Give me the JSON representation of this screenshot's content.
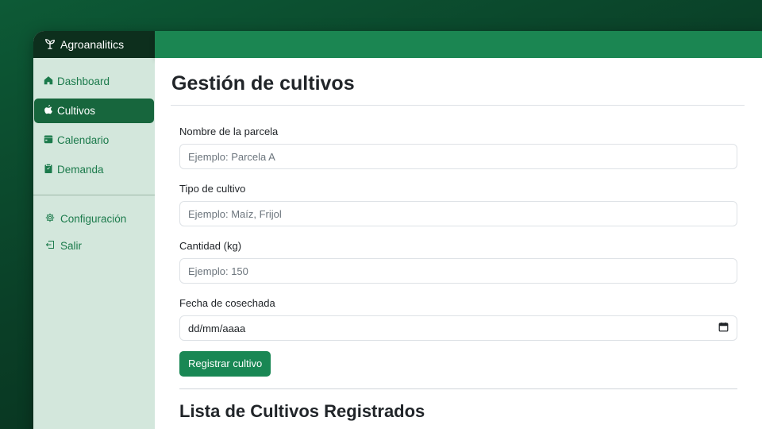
{
  "app": {
    "brand": "Agroanalitics"
  },
  "sidebar": {
    "items": [
      {
        "label": "Dashboard",
        "icon": "house-icon"
      },
      {
        "label": "Cultivos",
        "icon": "apple-icon",
        "active": true
      },
      {
        "label": "Calendario",
        "icon": "calendar-icon"
      },
      {
        "label": "Demanda",
        "icon": "clipboard-icon"
      }
    ],
    "secondary": [
      {
        "label": "Configuración",
        "icon": "gear-icon"
      },
      {
        "label": "Salir",
        "icon": "logout-icon"
      }
    ]
  },
  "page": {
    "title": "Gestión de cultivos"
  },
  "form": {
    "parcela": {
      "label": "Nombre de la parcela",
      "placeholder": "Ejemplo: Parcela A"
    },
    "cultivo": {
      "label": "Tipo de cultivo",
      "placeholder": "Ejemplo: Maíz, Frijol"
    },
    "cantidad": {
      "label": "Cantidad (kg)",
      "placeholder": "Ejemplo: 150"
    },
    "fecha": {
      "label": "Fecha de cosechada",
      "value": "dd/mm/aaaa"
    },
    "submit_label": "Registrar cultivo"
  },
  "list": {
    "title": "Lista de Cultivos Registrados"
  },
  "colors": {
    "primary": "#198754",
    "sidebar": "#d3e7dc",
    "brand_bg": "#0d2f1d",
    "topbar": "#1b8652"
  }
}
